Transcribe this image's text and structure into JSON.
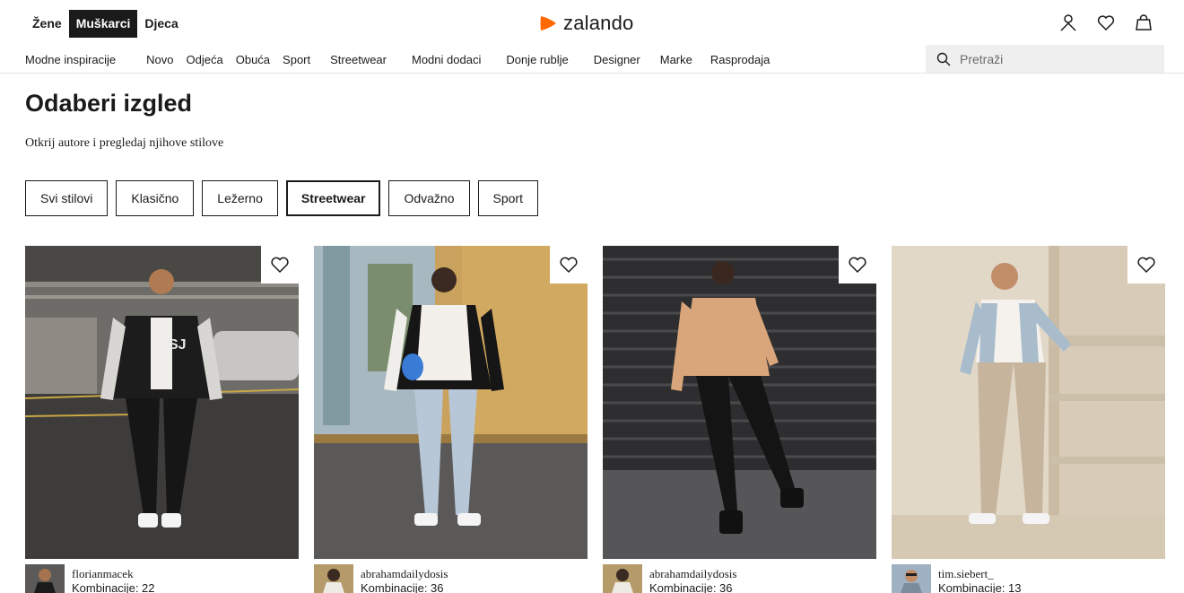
{
  "header": {
    "gender_tabs": [
      "Žene",
      "Muškarci",
      "Djeca"
    ],
    "active_gender": "Muškarci",
    "logo_text": "zalando",
    "icons": [
      "user-icon",
      "heart-icon",
      "bag-icon"
    ]
  },
  "nav": {
    "items": [
      "Modne inspiracije",
      "Novo",
      "Odjeća",
      "Obuća",
      "Sport",
      "Streetwear",
      "Modni dodaci",
      "Donje rublje",
      "Designer",
      "Marke",
      "Rasprodaja"
    ],
    "search_placeholder": "Pretraži"
  },
  "page": {
    "title": "Odaberi izgled",
    "subtitle": "Otkrij autore i pregledaj njihove stilove"
  },
  "filters": {
    "items": [
      "Svi stilovi",
      "Klasično",
      "Ležerno",
      "Streetwear",
      "Odvažno",
      "Sport"
    ],
    "active": "Streetwear"
  },
  "cards": [
    {
      "author": "florianmacek",
      "combinations": "Kombinacije: 22"
    },
    {
      "author": "abrahamdailydosis",
      "combinations": "Kombinacije: 36"
    },
    {
      "author": "abrahamdailydosis",
      "combinations": "Kombinacije: 36"
    },
    {
      "author": "tim.siebert_",
      "combinations": "Kombinacije: 13"
    }
  ],
  "colors": {
    "brand_orange": "#ff6900",
    "text": "#1a1a1a",
    "search_bg": "#efeff0"
  }
}
